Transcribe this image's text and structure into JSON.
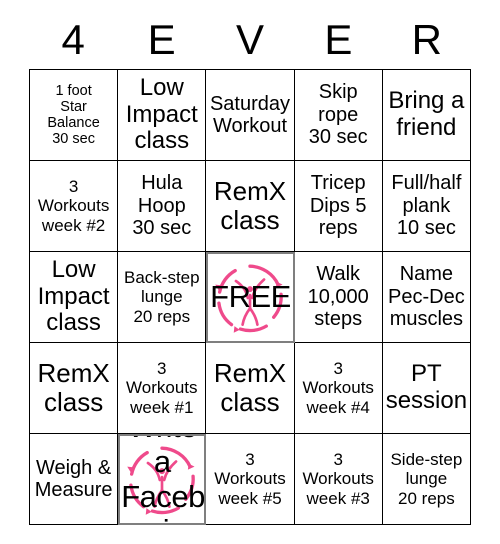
{
  "header": {
    "letters": [
      "4",
      "E",
      "V",
      "E",
      "R"
    ]
  },
  "brand": {
    "logo_color": "#ef4a8b",
    "logo_name": "pink-fitness-figure-ring-logo",
    "grid_line_color": "#000000",
    "highlight_border_color": "#7f7f7f"
  },
  "grid": {
    "rows": 5,
    "columns": 5,
    "cells": [
      {
        "text": "1 foot\nStar\nBalance\n30 sec",
        "size": "xs",
        "free": false,
        "logo": false
      },
      {
        "text": "Low\nImpact\nclass",
        "size": "l",
        "free": false,
        "logo": false
      },
      {
        "text": "Saturday\nWorkout",
        "size": "m",
        "free": false,
        "logo": false
      },
      {
        "text": "Skip\nrope\n30 sec",
        "size": "m",
        "free": false,
        "logo": false
      },
      {
        "text": "Bring a\nfriend",
        "size": "l",
        "free": false,
        "logo": false
      },
      {
        "text": "3\nWorkouts\nweek #2",
        "size": "s",
        "free": false,
        "logo": false
      },
      {
        "text": "Hula\nHoop\n30 sec",
        "size": "m",
        "free": false,
        "logo": false
      },
      {
        "text": "RemX\nclass",
        "size": "xl",
        "free": false,
        "logo": false
      },
      {
        "text": "Tricep\nDips 5\nreps",
        "size": "m",
        "free": false,
        "logo": false
      },
      {
        "text": "Full/half\nplank\n10 sec",
        "size": "m",
        "free": false,
        "logo": false
      },
      {
        "text": "Low\nImpact\nclass",
        "size": "l",
        "free": false,
        "logo": false
      },
      {
        "text": "Back-step\nlunge\n20 reps",
        "size": "s",
        "free": false,
        "logo": false
      },
      {
        "text": "FREE",
        "size": "l",
        "free": true,
        "logo": true
      },
      {
        "text": "Walk\n10,000\nsteps",
        "size": "m",
        "free": false,
        "logo": false
      },
      {
        "text": "Name\nPec-Dec\nmuscles",
        "size": "m",
        "free": false,
        "logo": false
      },
      {
        "text": "RemX\nclass",
        "size": "xl",
        "free": false,
        "logo": false
      },
      {
        "text": "3\nWorkouts\nweek #1",
        "size": "s",
        "free": false,
        "logo": false
      },
      {
        "text": "RemX\nclass",
        "size": "xl",
        "free": false,
        "logo": false
      },
      {
        "text": "3\nWorkouts\nweek #4",
        "size": "s",
        "free": false,
        "logo": false
      },
      {
        "text": "PT\nsession",
        "size": "l",
        "free": false,
        "logo": false
      },
      {
        "text": "Weigh &\nMeasure",
        "size": "m",
        "free": false,
        "logo": false
      },
      {
        "text": "Write a\nFacebook\nreview",
        "size": "s",
        "free": true,
        "logo": true
      },
      {
        "text": "3\nWorkouts\nweek #5",
        "size": "s",
        "free": false,
        "logo": false
      },
      {
        "text": "3\nWorkouts\nweek #3",
        "size": "s",
        "free": false,
        "logo": false
      },
      {
        "text": "Side-step\nlunge\n20 reps",
        "size": "s",
        "free": false,
        "logo": false
      }
    ]
  }
}
